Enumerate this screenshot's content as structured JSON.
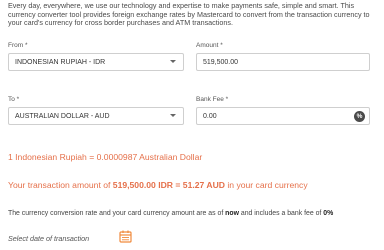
{
  "intro": {
    "text": "Every day, everywhere, we use our technology and expertise to make payments safe, simple and smart. This currency converter tool provides foreign exchange rates by Mastercard to convert from the transaction currency to your card's currency for cross border purchases and ATM transactions."
  },
  "form": {
    "from_label": "From *",
    "from_value": "INDONESIAN RUPIAH - IDR",
    "amount_label": "Amount *",
    "amount_value": "519,500.00",
    "to_label": "To *",
    "to_value": "AUSTRALIAN DOLLAR - AUD",
    "bank_fee_label": "Bank Fee *",
    "bank_fee_value": "0.00",
    "bank_fee_unit": "%"
  },
  "result": {
    "rate_text": "1 Indonesian Rupiah = 0.0000987 Australian Dollar",
    "txn_prefix": "Your transaction amount of ",
    "txn_equation": "519,500.00 IDR = 51.27 AUD",
    "txn_suffix": " in your card currency",
    "note_prefix": "The currency conversion rate and your card currency amount are as of ",
    "note_now": "now",
    "note_mid": " and includes a bank fee of ",
    "note_fee": "0%"
  },
  "date": {
    "label": "Select date of transaction"
  },
  "colors": {
    "accent": "#e5704a",
    "icon": "#f08a3c"
  }
}
